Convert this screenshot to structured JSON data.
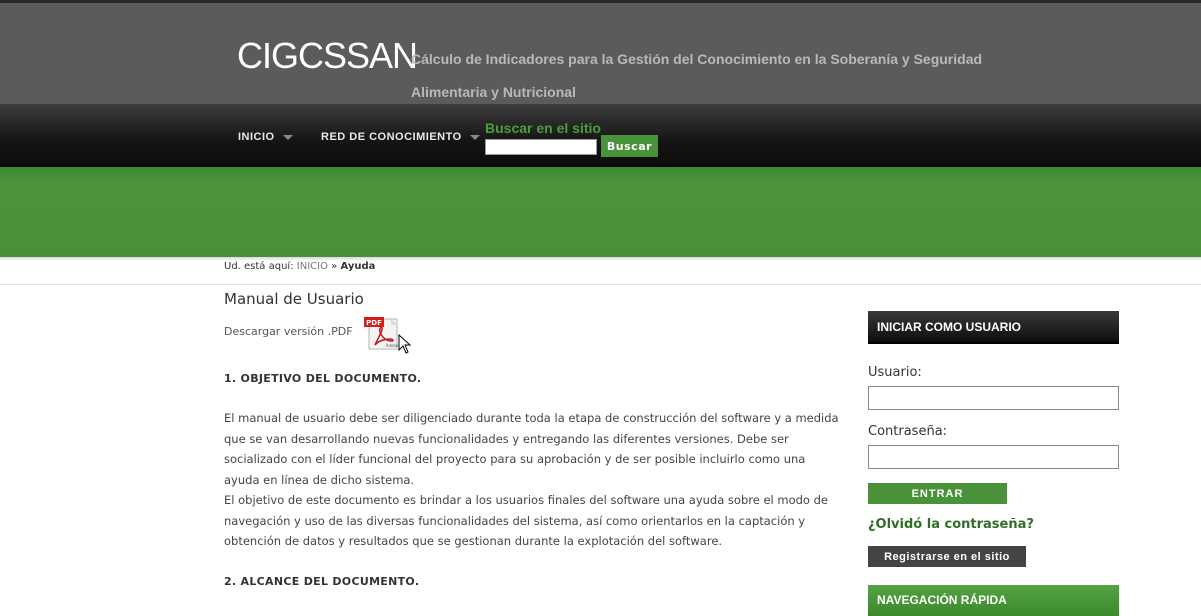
{
  "header": {
    "site_title": "CIGCSSAN",
    "site_description": "Cálculo de Indicadores para la Gestión del Conocimiento en la Soberanía y Seguridad Alimentaria y Nutricional"
  },
  "nav": {
    "items": [
      {
        "label": "INICIO",
        "icon": "chevron-down-icon"
      },
      {
        "label": "RED DE CONOCIMIENTO",
        "icon": "chevron-down-icon"
      }
    ],
    "search": {
      "title": "Buscar en el sitio",
      "input_value": "",
      "button_label": "Buscar"
    }
  },
  "breadcrumb": {
    "prefix": "Ud. está aquí:",
    "home": "INICIO",
    "separator": "»",
    "current": "Ayuda"
  },
  "main": {
    "title": "Manual de Usuario",
    "download_label": "Descargar versión .PDF",
    "pdf_icon": {
      "name": "pdf-adobe-icon",
      "badge": "PDF",
      "brand": "Adobe"
    },
    "sections": [
      {
        "heading": "1. OBJETIVO DEL DOCUMENTO.",
        "paragraphs": [
          "El manual de usuario debe ser diligenciado durante toda la etapa de construcción del software y a medida que se van desarrollando nuevas funcionalidades y entregando las diferentes versiones. Debe ser socializado con el líder funcional del proyecto para su aprobación y de ser posible incluirlo como una ayuda en línea de dicho sistema.",
          "El objetivo de este documento es brindar a los usuarios finales del software una ayuda sobre el modo de navegación y uso de las diversas funcionalidades del sistema, así como orientarlos en la captación y obtención de datos y resultados que se gestionan durante la explotación del software."
        ]
      },
      {
        "heading": "2. ALCANCE DEL DOCUMENTO.",
        "paragraphs": []
      }
    ]
  },
  "sidebar": {
    "login_box": {
      "title": "INICIAR COMO USUARIO",
      "username_label": "Usuario:",
      "username_value": "",
      "password_label": "Contraseña:",
      "password_value": "",
      "enter_label": "ENTRAR",
      "forgot_label": "¿Olvidó la contraseña?",
      "register_label": "Registrarse en el sitio"
    },
    "quick_nav": {
      "title": "NAVEGACIÓN RÁPIDA"
    }
  },
  "colors": {
    "header_bg": "#5b5b5b",
    "nav_bg": "#141414",
    "brand_green": "#4a8f39",
    "link_green": "#2f6e26"
  }
}
